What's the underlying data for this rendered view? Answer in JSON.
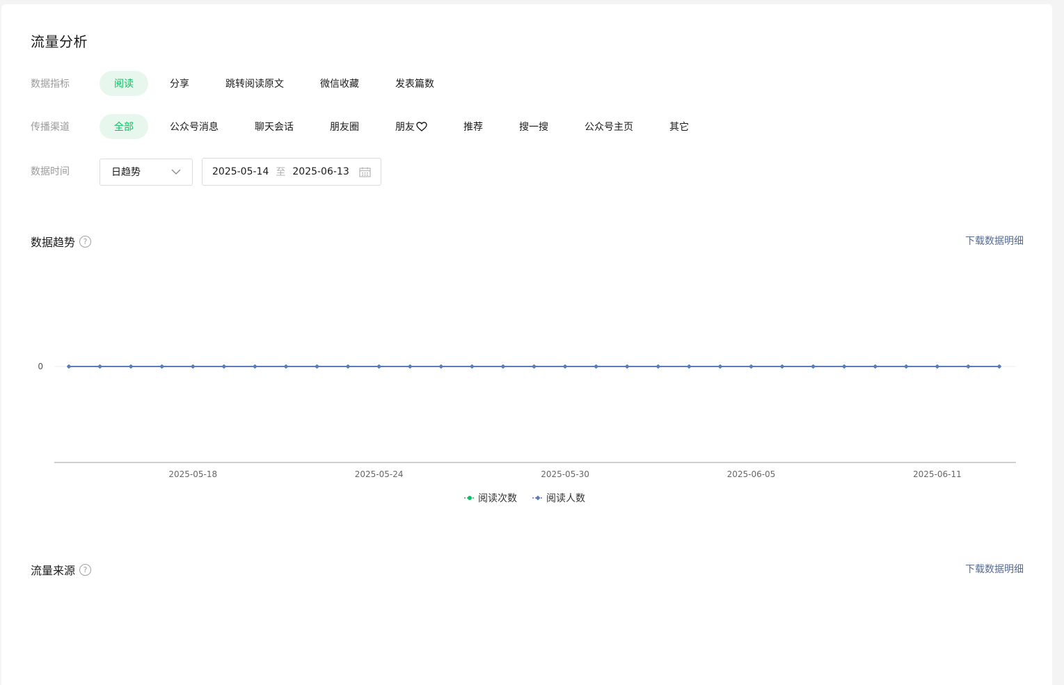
{
  "page": {
    "title": "流量分析"
  },
  "filters": {
    "metric": {
      "label": "数据指标",
      "options": [
        "阅读",
        "分享",
        "跳转阅读原文",
        "微信收藏",
        "发表篇数"
      ],
      "selected": "阅读"
    },
    "channel": {
      "label": "传播渠道",
      "options": [
        "全部",
        "公众号消息",
        "聊天会话",
        "朋友圈",
        "朋友",
        "推荐",
        "搜一搜",
        "公众号主页",
        "其它"
      ],
      "selected": "全部"
    },
    "time": {
      "label": "数据时间",
      "granularity": "日趋势",
      "start": "2025-05-14",
      "separator": "至",
      "end": "2025-06-13"
    }
  },
  "trend": {
    "title": "数据趋势",
    "download_label": "下载数据明细"
  },
  "source": {
    "title": "流量来源",
    "download_label": "下载数据明细"
  },
  "colors": {
    "accent": "#07c160",
    "series_read_count": "#07c160",
    "series_readers": "#5b7bc0",
    "link": "#576b95"
  },
  "chart_data": {
    "type": "line",
    "x": [
      "2025-05-14",
      "2025-05-15",
      "2025-05-16",
      "2025-05-17",
      "2025-05-18",
      "2025-05-19",
      "2025-05-20",
      "2025-05-21",
      "2025-05-22",
      "2025-05-23",
      "2025-05-24",
      "2025-05-25",
      "2025-05-26",
      "2025-05-27",
      "2025-05-28",
      "2025-05-29",
      "2025-05-30",
      "2025-05-31",
      "2025-06-01",
      "2025-06-02",
      "2025-06-03",
      "2025-06-04",
      "2025-06-05",
      "2025-06-06",
      "2025-06-07",
      "2025-06-08",
      "2025-06-09",
      "2025-06-10",
      "2025-06-11",
      "2025-06-12",
      "2025-06-13"
    ],
    "x_tick_labels": [
      "2025-05-18",
      "2025-05-24",
      "2025-05-30",
      "2025-06-05",
      "2025-06-11"
    ],
    "y_tick_labels": [
      "0"
    ],
    "series": [
      {
        "name": "阅读次数",
        "values": [
          0,
          0,
          0,
          0,
          0,
          0,
          0,
          0,
          0,
          0,
          0,
          0,
          0,
          0,
          0,
          0,
          0,
          0,
          0,
          0,
          0,
          0,
          0,
          0,
          0,
          0,
          0,
          0,
          0,
          0,
          0
        ]
      },
      {
        "name": "阅读人数",
        "values": [
          0,
          0,
          0,
          0,
          0,
          0,
          0,
          0,
          0,
          0,
          0,
          0,
          0,
          0,
          0,
          0,
          0,
          0,
          0,
          0,
          0,
          0,
          0,
          0,
          0,
          0,
          0,
          0,
          0,
          0,
          0
        ]
      }
    ],
    "legend_position": "bottom-center"
  }
}
